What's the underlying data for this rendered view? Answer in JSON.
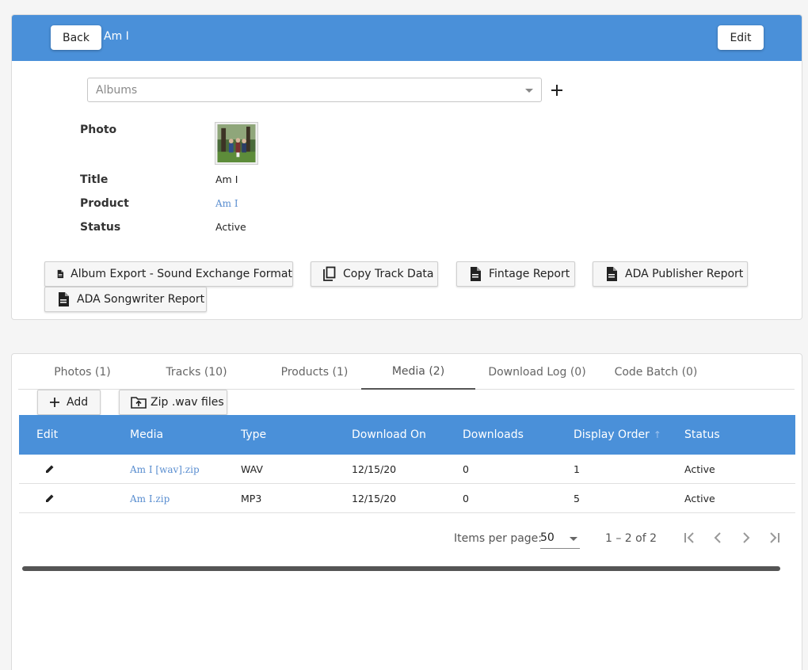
{
  "header": {
    "back_label": "Back",
    "title": "Am I",
    "edit_label": "Edit"
  },
  "albums_select": {
    "placeholder": "Albums"
  },
  "fields": {
    "photo_label": "Photo",
    "title_label": "Title",
    "title_value": "Am I",
    "product_label": "Product",
    "product_value": "Am I",
    "status_label": "Status",
    "status_value": "Active"
  },
  "actions": [
    "Album Export - Sound Exchange Format",
    "Copy Track Data",
    "Fintage Report",
    "ADA Publisher Report",
    "ADA Songwriter Report"
  ],
  "tabs": [
    {
      "label": "Photos (1)"
    },
    {
      "label": "Tracks (10)"
    },
    {
      "label": "Products (1)"
    },
    {
      "label": "Media (2)"
    },
    {
      "label": "Download Log (0)"
    },
    {
      "label": "Code Batch (0)"
    }
  ],
  "active_tab": "Media (2)",
  "toolbar": {
    "add_label": "Add",
    "zip_label": "Zip .wav files"
  },
  "table": {
    "columns": [
      "Edit",
      "Media",
      "Type",
      "Download On",
      "Downloads",
      "Display Order",
      "Status"
    ],
    "rows": [
      {
        "media": "Am I [wav].zip",
        "type": "WAV",
        "download_on": "12/15/20",
        "downloads": "0",
        "display_order": "1",
        "status": "Active"
      },
      {
        "media": "Am I.zip",
        "type": "MP3",
        "download_on": "12/15/20",
        "downloads": "0",
        "display_order": "5",
        "status": "Active"
      }
    ]
  },
  "paginator": {
    "items_per_page_label": "Items per page:",
    "items_per_page_value": "50",
    "range_label": "1 – 2 of 2"
  },
  "colors": {
    "accent": "#4a90d9",
    "link": "#5a8ed0"
  }
}
